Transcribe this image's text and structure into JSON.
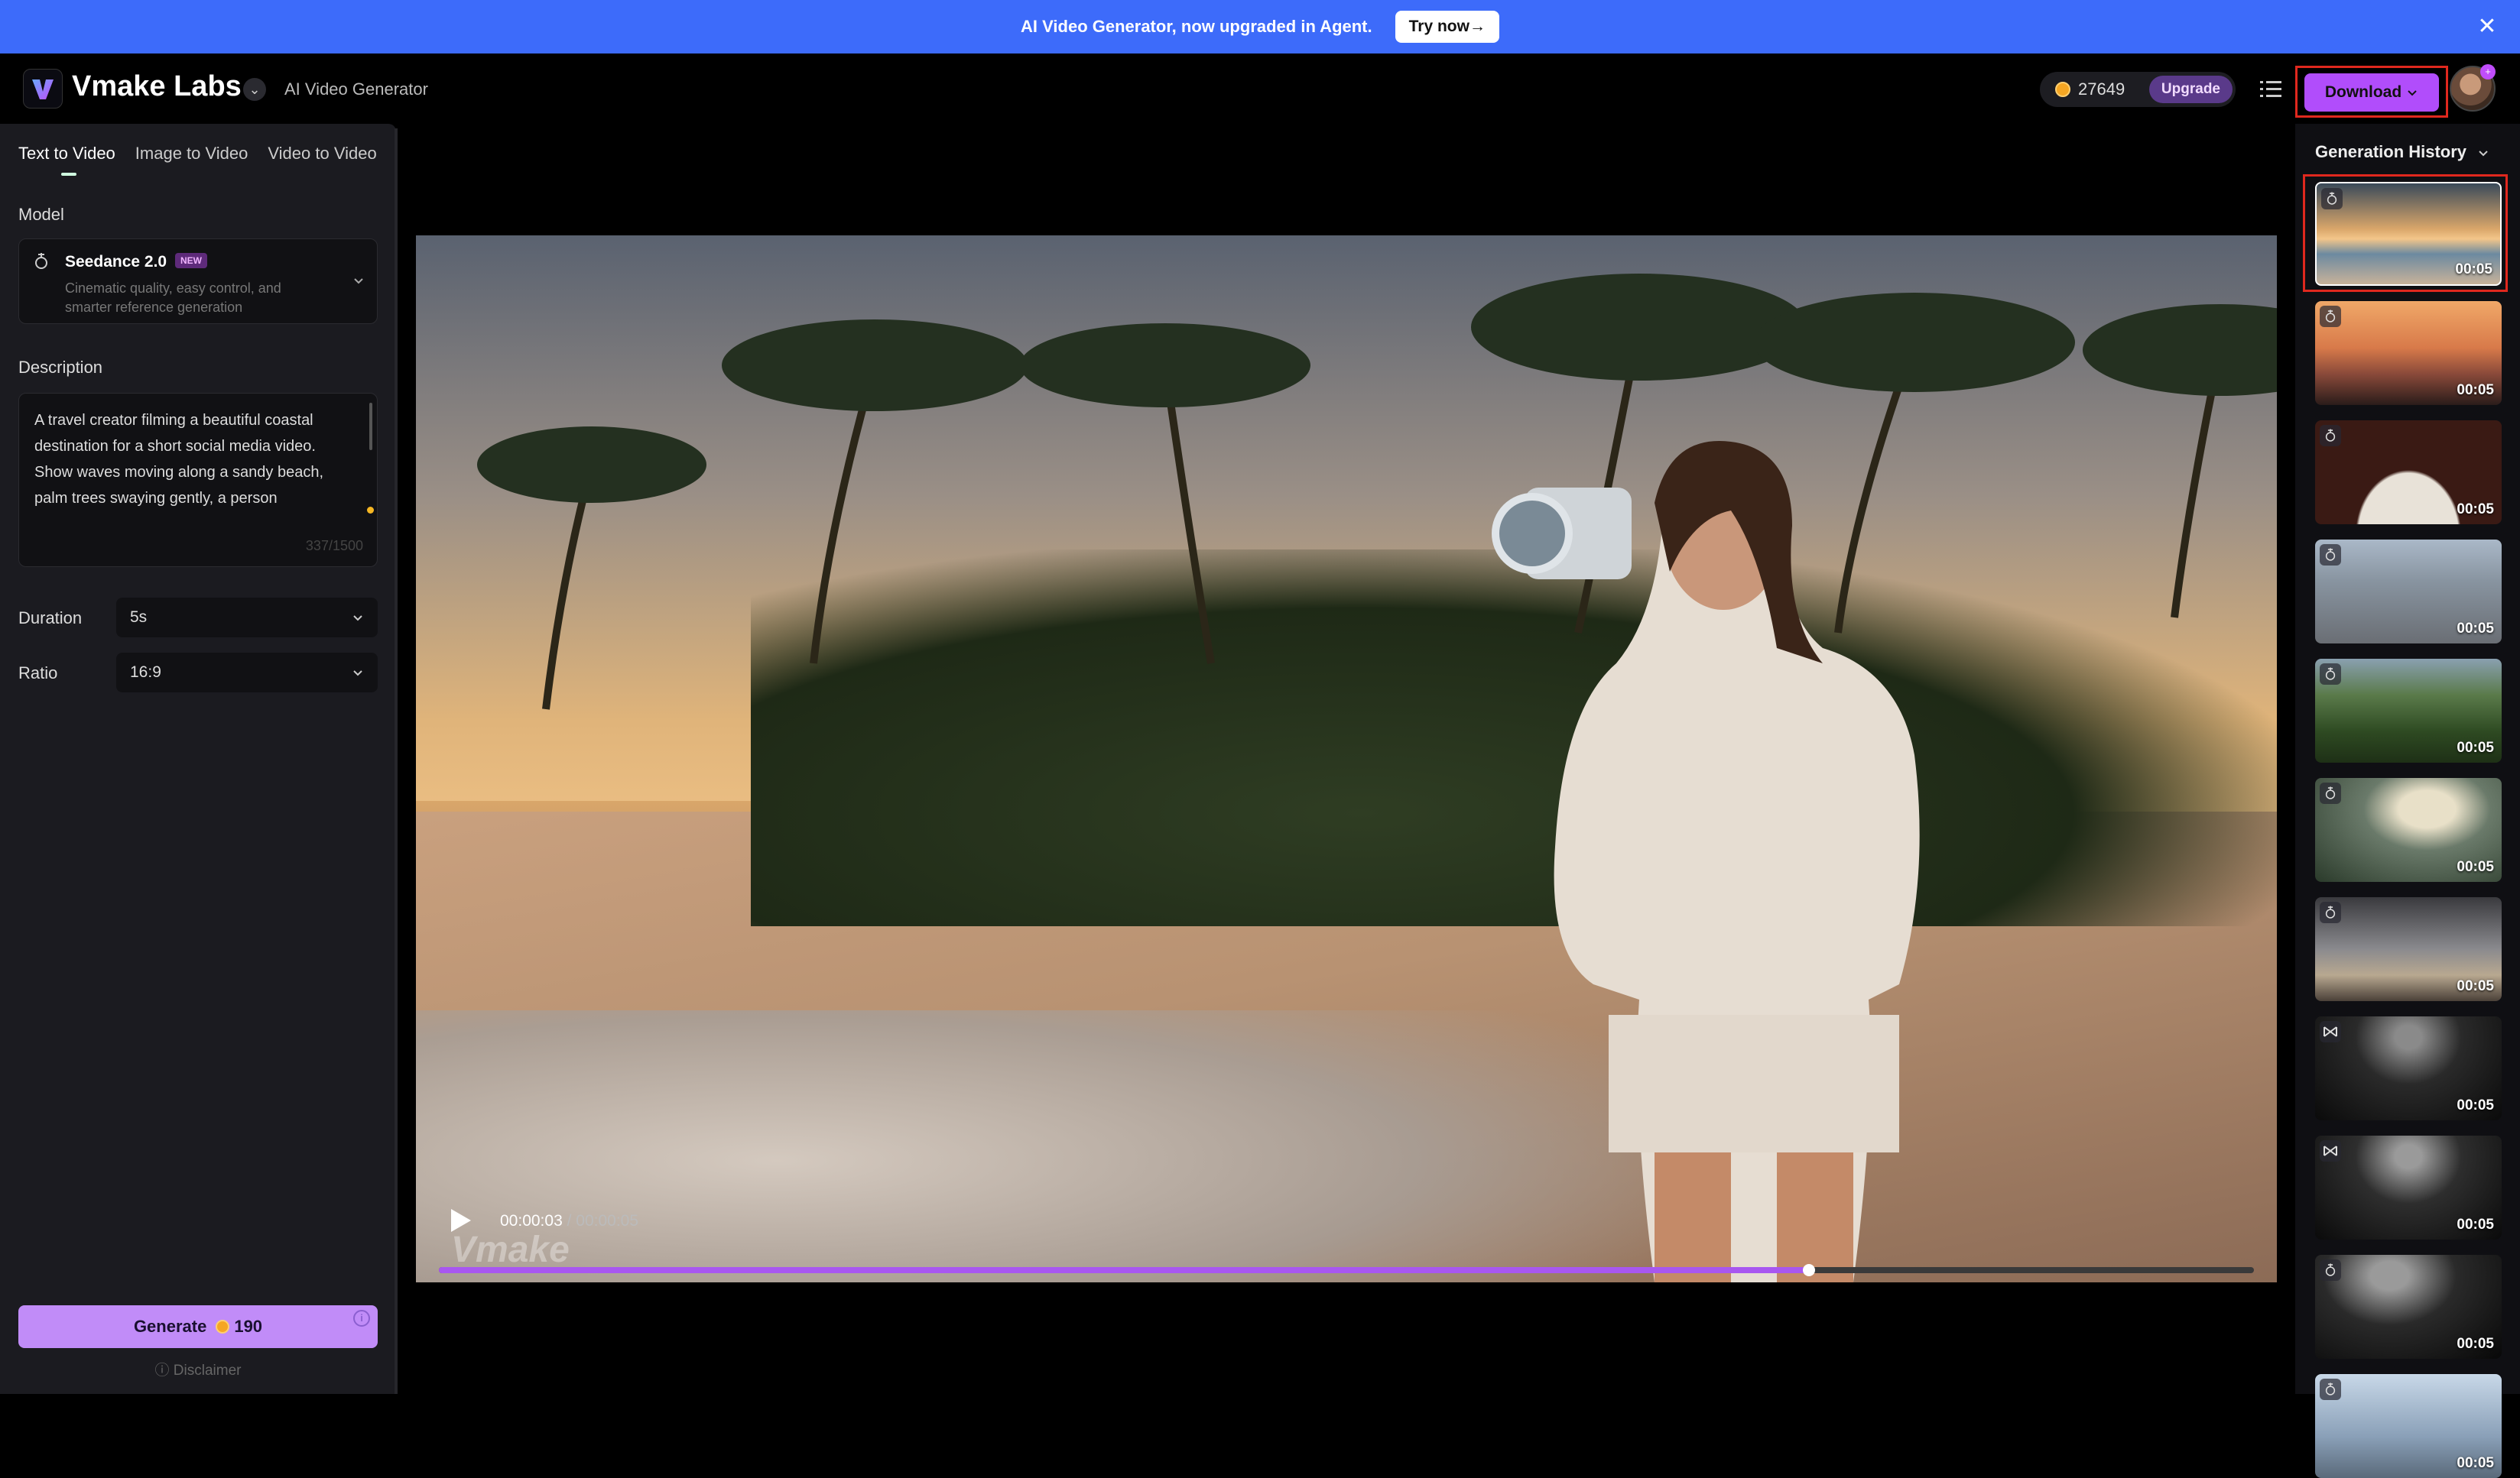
{
  "banner": {
    "text": "AI Video Generator, now upgraded in Agent.",
    "cta": "Try now→",
    "close": "✕"
  },
  "header": {
    "brand": "Vmake Labs",
    "subtitle": "AI Video Generator",
    "credits": "27649",
    "upgrade": "Upgrade",
    "download": "Download",
    "avatar_badge": "+"
  },
  "left": {
    "tabs": [
      "Text to Video",
      "Image to Video",
      "Video to Video"
    ],
    "model_label": "Model",
    "model": {
      "name": "Seedance 2.0",
      "badge": "NEW",
      "desc": "Cinematic quality, easy control, and smarter reference generation"
    },
    "description_label": "Description",
    "description": "A travel creator filming a beautiful coastal destination for a short social media video. Show waves moving along a sandy beach, palm trees swaying gently, a person",
    "char_count": "337/1500",
    "duration_label": "Duration",
    "duration_value": "5s",
    "ratio_label": "Ratio",
    "ratio_value": "16:9",
    "generate_label": "Generate",
    "generate_cost": "190",
    "disclaimer": "ⓘ Disclaimer"
  },
  "player": {
    "watermark": "Vmake",
    "time_current": "00:00:03",
    "time_total": "/ 00:00:05",
    "progress": 0.755
  },
  "history": {
    "title": "Generation History",
    "items": [
      {
        "duration": "00:05",
        "icon": "seedance-icon",
        "bg": "linear-gradient(180deg,#3a4a5a 0%,#d9a66a 45%,#f3c68a 55%,#6c8aa0 70%,#c8b29a 100%)"
      },
      {
        "duration": "00:05",
        "icon": "seedance-icon",
        "bg": "linear-gradient(180deg,#f0a868 0%,#d87a4a 45%,#8a4a3a 70%,#2a1c1a 100%)"
      },
      {
        "duration": "00:05",
        "icon": "seedance-icon",
        "bg": "radial-gradient(ellipse at 50% 110%,#e8e2d8 0 38%,#3a1a14 40% 100%)"
      },
      {
        "duration": "00:05",
        "icon": "seedance-icon",
        "bg": "linear-gradient(180deg,#aab8c8 0%,#8894a0 40%,#6a6e74 100%)"
      },
      {
        "duration": "00:05",
        "icon": "seedance-icon",
        "bg": "linear-gradient(180deg,#8aa0b0 0%,#5a7a4a 35%,#2e4a22 70%,#1e3016 100%)"
      },
      {
        "duration": "00:05",
        "icon": "seedance-icon",
        "bg": "radial-gradient(ellipse at 60% 30%,#e8e0c8 0 18%,#6a7a6a 40%,#2a3a2a 100%)"
      },
      {
        "duration": "00:05",
        "icon": "seedance-icon",
        "bg": "linear-gradient(180deg,#3a3a3e 0%,#8a8a8e 50%,#b8a890 75%,#4a4038 100%)"
      },
      {
        "duration": "00:05",
        "icon": "kling-icon",
        "bg": "radial-gradient(ellipse at 50% 20%,#8a8a8a 0 10%,#2a2a2a 40%,#0a0a0a 100%)"
      },
      {
        "duration": "00:05",
        "icon": "kling-icon",
        "bg": "radial-gradient(ellipse at 50% 20%,#9a9a9a 0 10%,#2e2e2e 40%,#0a0a0a 100%)"
      },
      {
        "duration": "00:05",
        "icon": "seedance-icon",
        "bg": "radial-gradient(ellipse at 40% 20%,#9a9a9a 0 12%,#2a2a2a 42%,#080808 100%)"
      },
      {
        "duration": "00:05",
        "icon": "seedance-icon",
        "bg": "linear-gradient(180deg,#c8d8e8 0%,#8aa0b8 60%,#5a6a7a 100%)"
      }
    ]
  },
  "colors": {
    "banner": "#3d6bfa",
    "accent": "#b14dfb",
    "highlight": "#e0281e",
    "progress": "#a857f0"
  }
}
